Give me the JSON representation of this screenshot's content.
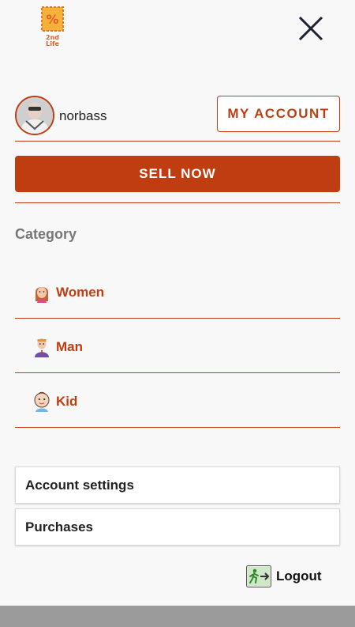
{
  "brand": {
    "logo_text": "2nd Life",
    "logo_symbol": "%",
    "close_icon": "close-icon"
  },
  "colors": {
    "accent": "#bf3d10",
    "background": "#f8f8f8",
    "bottom_bar": "#9b9b9b"
  },
  "user": {
    "name": "norbass",
    "avatar": "avatar-photo"
  },
  "buttons": {
    "my_account": "MY ACCOUNT",
    "sell_now": "SELL NOW"
  },
  "category": {
    "title": "Category",
    "items": [
      {
        "label": "Women",
        "icon": "woman-icon"
      },
      {
        "label": "Man",
        "icon": "man-icon"
      },
      {
        "label": "Kid",
        "icon": "kid-icon"
      }
    ]
  },
  "menu": {
    "account_settings": "Account settings",
    "purchases": "Purchases"
  },
  "logout": {
    "label": "Logout",
    "icon": "exit-icon"
  }
}
